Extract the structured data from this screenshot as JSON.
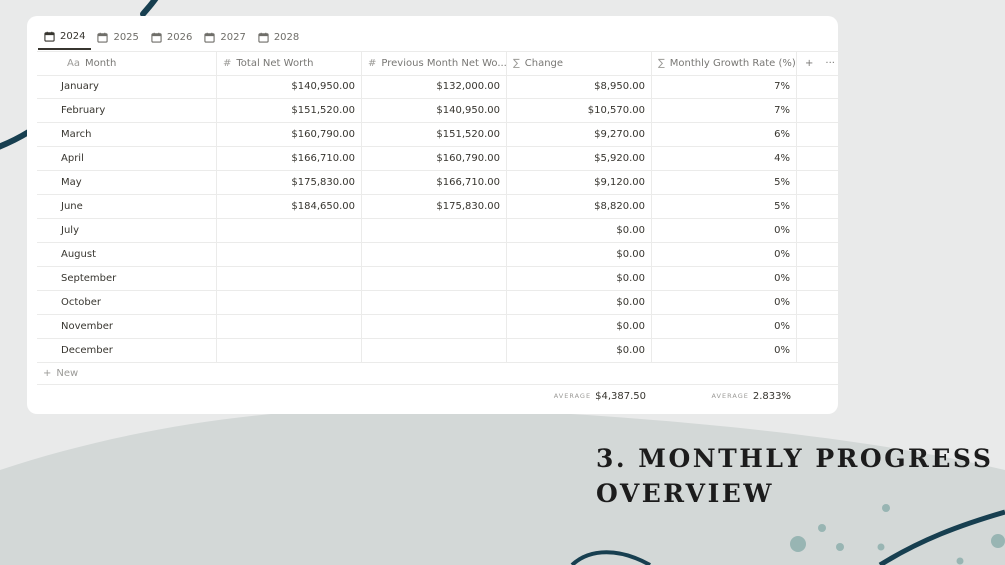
{
  "tabs": [
    "2024",
    "2025",
    "2026",
    "2027",
    "2028"
  ],
  "active_tab": "2024",
  "columns": {
    "month": {
      "icon": "Aa",
      "label": "Month"
    },
    "total": {
      "icon": "#",
      "label": "Total Net Worth"
    },
    "previous": {
      "icon": "#",
      "label": "Previous Month Net Wo..."
    },
    "change": {
      "icon": "∑",
      "label": "Change"
    },
    "growth": {
      "icon": "∑",
      "label": "Monthly Growth Rate (%)"
    },
    "add": "+",
    "more": "···"
  },
  "rows": [
    {
      "month": "January",
      "total": "$140,950.00",
      "previous": "$132,000.00",
      "change": "$8,950.00",
      "growth": "7%"
    },
    {
      "month": "February",
      "total": "$151,520.00",
      "previous": "$140,950.00",
      "change": "$10,570.00",
      "growth": "7%"
    },
    {
      "month": "March",
      "total": "$160,790.00",
      "previous": "$151,520.00",
      "change": "$9,270.00",
      "growth": "6%"
    },
    {
      "month": "April",
      "total": "$166,710.00",
      "previous": "$160,790.00",
      "change": "$5,920.00",
      "growth": "4%"
    },
    {
      "month": "May",
      "total": "$175,830.00",
      "previous": "$166,710.00",
      "change": "$9,120.00",
      "growth": "5%"
    },
    {
      "month": "June",
      "total": "$184,650.00",
      "previous": "$175,830.00",
      "change": "$8,820.00",
      "growth": "5%"
    },
    {
      "month": "July",
      "total": "",
      "previous": "",
      "change": "$0.00",
      "growth": "0%"
    },
    {
      "month": "August",
      "total": "",
      "previous": "",
      "change": "$0.00",
      "growth": "0%"
    },
    {
      "month": "September",
      "total": "",
      "previous": "",
      "change": "$0.00",
      "growth": "0%"
    },
    {
      "month": "October",
      "total": "",
      "previous": "",
      "change": "$0.00",
      "growth": "0%"
    },
    {
      "month": "November",
      "total": "",
      "previous": "",
      "change": "$0.00",
      "growth": "0%"
    },
    {
      "month": "December",
      "total": "",
      "previous": "",
      "change": "$0.00",
      "growth": "0%"
    }
  ],
  "new_row": {
    "icon": "+",
    "label": "New"
  },
  "footer": {
    "change_label": "AVERAGE",
    "change_value": "$4,387.50",
    "growth_label": "AVERAGE",
    "growth_value": "2.833%"
  },
  "heading": {
    "line1": "3. MONTHLY PROGRESS",
    "line2": "OVERVIEW"
  },
  "colors": {
    "accent_navy": "#173f50",
    "dot_teal": "#98b5b3",
    "blob": "#d2d7d6",
    "background": "#e9eaea"
  }
}
